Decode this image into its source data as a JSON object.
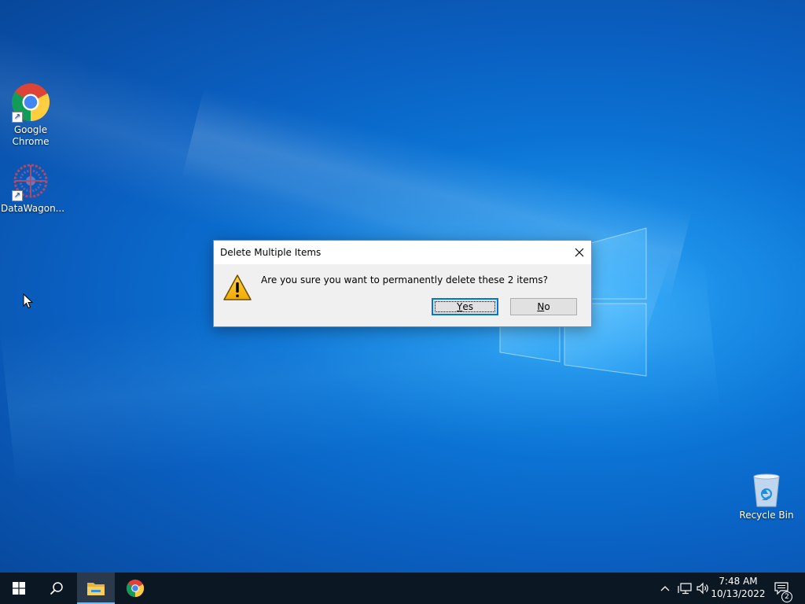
{
  "desktop": {
    "icons": [
      {
        "label_line1": "Google",
        "label_line2": "Chrome",
        "icon": "chrome-icon"
      },
      {
        "label_line1": "DataWagon...",
        "icon": "datawagon-icon"
      },
      {
        "label_line1": "Recycle Bin",
        "icon": "recycle-bin-icon"
      }
    ]
  },
  "dialog": {
    "title": "Delete Multiple Items",
    "message": "Are you sure you want to permanently delete these 2 items?",
    "icon": "warning-icon",
    "yes_mnemonic": "Y",
    "yes_rest": "es",
    "no_mnemonic": "N",
    "no_rest": "o"
  },
  "taskbar": {
    "start_icon": "windows-start-icon",
    "search_icon": "search-icon",
    "pinned": [
      "file-explorer-icon",
      "chrome-icon"
    ],
    "tray_icons": [
      "chevron-up-icon",
      "network-icon",
      "volume-icon"
    ],
    "time": "7:48 AM",
    "date": "10/13/2022",
    "notification_count": "2"
  },
  "colors": {
    "desktop_blue": "#0b73d4",
    "taskbar": "#0b1723",
    "accent": "#0078d7"
  }
}
